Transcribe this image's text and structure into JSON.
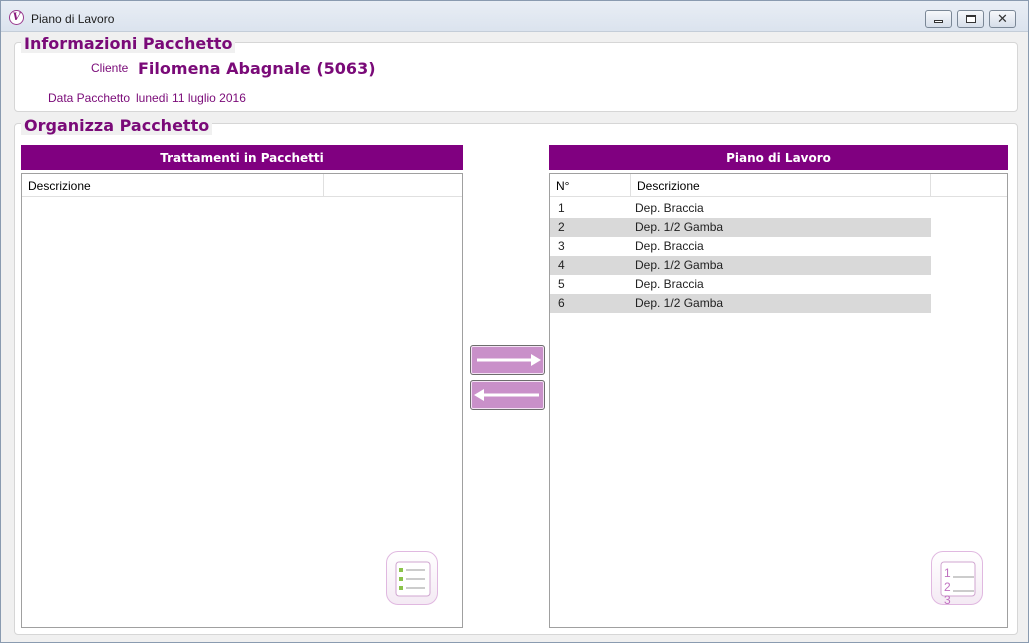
{
  "window": {
    "title": "Piano di Lavoro",
    "icon": "app-logo-icon",
    "controls": [
      "minimize-icon",
      "maximize-icon",
      "close-icon"
    ]
  },
  "info": {
    "title": "Informazioni Pacchetto",
    "cliente_label": "Cliente",
    "cliente_value": "Filomena Abagnale (5063)",
    "data_label": "Data Pacchetto",
    "data_value": "lunedì 11 luglio 2016"
  },
  "organizza": {
    "title": "Organizza Pacchetto",
    "left_panel": {
      "header": "Trattamenti in Pacchetti",
      "columns": [
        "Descrizione",
        ""
      ],
      "rows": []
    },
    "right_panel": {
      "header": "Piano di Lavoro",
      "columns": [
        "N°",
        "Descrizione",
        ""
      ],
      "rows": [
        {
          "num": "1",
          "desc": "Dep. Braccia"
        },
        {
          "num": "2",
          "desc": "Dep. 1/2 Gamba"
        },
        {
          "num": "3",
          "desc": "Dep. Braccia"
        },
        {
          "num": "4",
          "desc": "Dep. 1/2 Gamba"
        },
        {
          "num": "5",
          "desc": "Dep. Braccia"
        },
        {
          "num": "6",
          "desc": "Dep. 1/2 Gamba"
        }
      ]
    },
    "buttons": {
      "move_right": "arrow-right-icon",
      "move_left": "arrow-left-icon"
    },
    "decorations": {
      "left": "checklist-icon",
      "right": "numbered-list-icon",
      "numbered_glyphs": [
        "1",
        "2",
        "3"
      ]
    }
  },
  "colors": {
    "accent": "#800080",
    "label": "#7a0a78",
    "button": "#c990c9",
    "row_alt": "#d9d9d9"
  }
}
